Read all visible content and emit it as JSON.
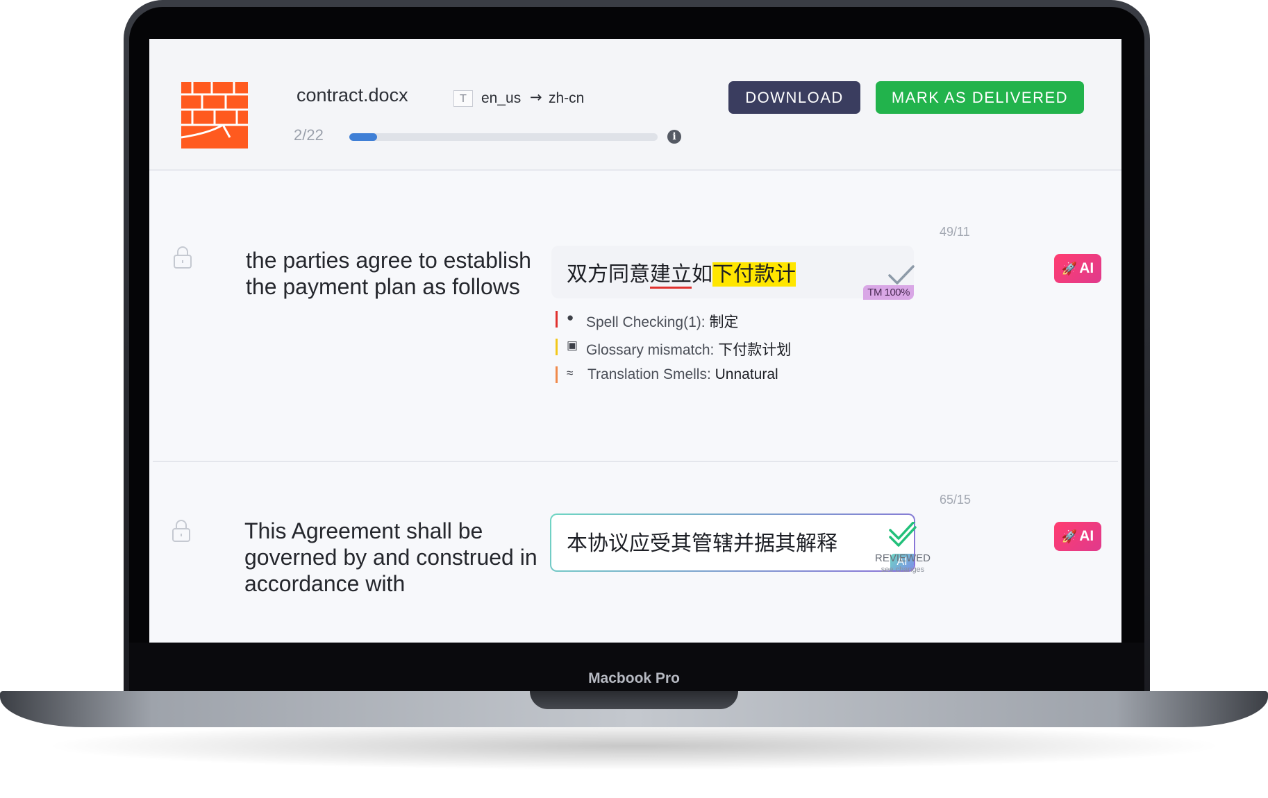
{
  "device": {
    "model_label": "Macbook Pro"
  },
  "header": {
    "file_name": "contract.docx",
    "type_badge": "T",
    "source_lang": "en_us",
    "arrow": "→",
    "target_lang": "zh-cn",
    "progress_text": "2/22",
    "progress": {
      "current": 2,
      "total": 22
    },
    "info_icon": "i",
    "download_label": "DOWNLOAD",
    "delivered_label": "MARK AS DELIVERED"
  },
  "colors": {
    "logo": "#ff5a1f",
    "download_button": "#3a3d5f",
    "delivered_button": "#22b34c",
    "progress": "#3f7fd6",
    "highlight": "#ffe600",
    "ai_button": "#ff3d70"
  },
  "segments": [
    {
      "source_text": "the parties agree to establish the payment plan as follows",
      "count": "49/11",
      "target_part1": "双方同意",
      "target_part2": "建立",
      "target_part3": "如",
      "target_highlight": "下付款计",
      "tm_badge": "TM 100%",
      "status_icon": "check-icon",
      "ai_button_label": "AI",
      "qa": [
        {
          "color": "#e0312f",
          "icon": "bulb-icon",
          "label": "Spell Checking(1):",
          "value": "制定"
        },
        {
          "color": "#f2c81b",
          "icon": "book-icon",
          "label": "Glossary mismatch:",
          "value": "下付款计划"
        },
        {
          "color": "#f08a4b",
          "icon": "smell-icon",
          "label": "Translation Smells:",
          "value": "Unnatural"
        }
      ]
    },
    {
      "source_text": "This Agreement shall be governed by and construed in accordance with",
      "count": "65/15",
      "target_text": "本协议应受其管辖并据其解释",
      "ai_tag": "AI",
      "status_icon": "double-check-icon",
      "reviewed_label": "REVIEWED",
      "see_changes": "see changes",
      "ai_button_label": "AI"
    }
  ]
}
